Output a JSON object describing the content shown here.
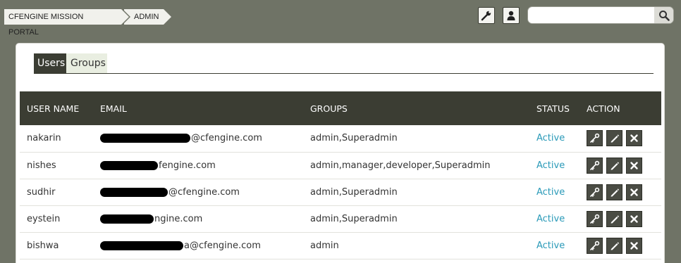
{
  "breadcrumb": {
    "items": [
      "CFENGINE MISSION PORTAL",
      "ADMIN"
    ]
  },
  "toolbar": {
    "settings_icon": "wrench-icon",
    "user_icon": "user-icon"
  },
  "search": {
    "placeholder": "",
    "value": "",
    "icon": "search-icon"
  },
  "tabs": [
    {
      "label": "Users",
      "active": true
    },
    {
      "label": "Groups",
      "active": false
    }
  ],
  "table": {
    "columns": [
      "USER NAME",
      "EMAIL",
      "GROUPS",
      "STATUS",
      "ACTION"
    ],
    "rows": [
      {
        "username": "nakarin",
        "email": "@cfengine.com",
        "groups": "admin,Superadmin",
        "status": "Active"
      },
      {
        "username": "nishes",
        "email": "fengine.com",
        "groups": "admin,manager,developer,Superadmin",
        "status": "Active"
      },
      {
        "username": "sudhir",
        "email": "@cfengine.com",
        "groups": "admin,Superadmin",
        "status": "Active"
      },
      {
        "username": "eystein",
        "email": "ngine.com",
        "groups": "admin,Superadmin",
        "status": "Active"
      },
      {
        "username": "bishwa",
        "email": "a@cfengine.com",
        "groups": "admin",
        "status": "Active"
      }
    ]
  },
  "colors": {
    "header_bg": "#3b3d33",
    "status_active": "#2a9ab8",
    "page_bg": "#6f7366"
  }
}
